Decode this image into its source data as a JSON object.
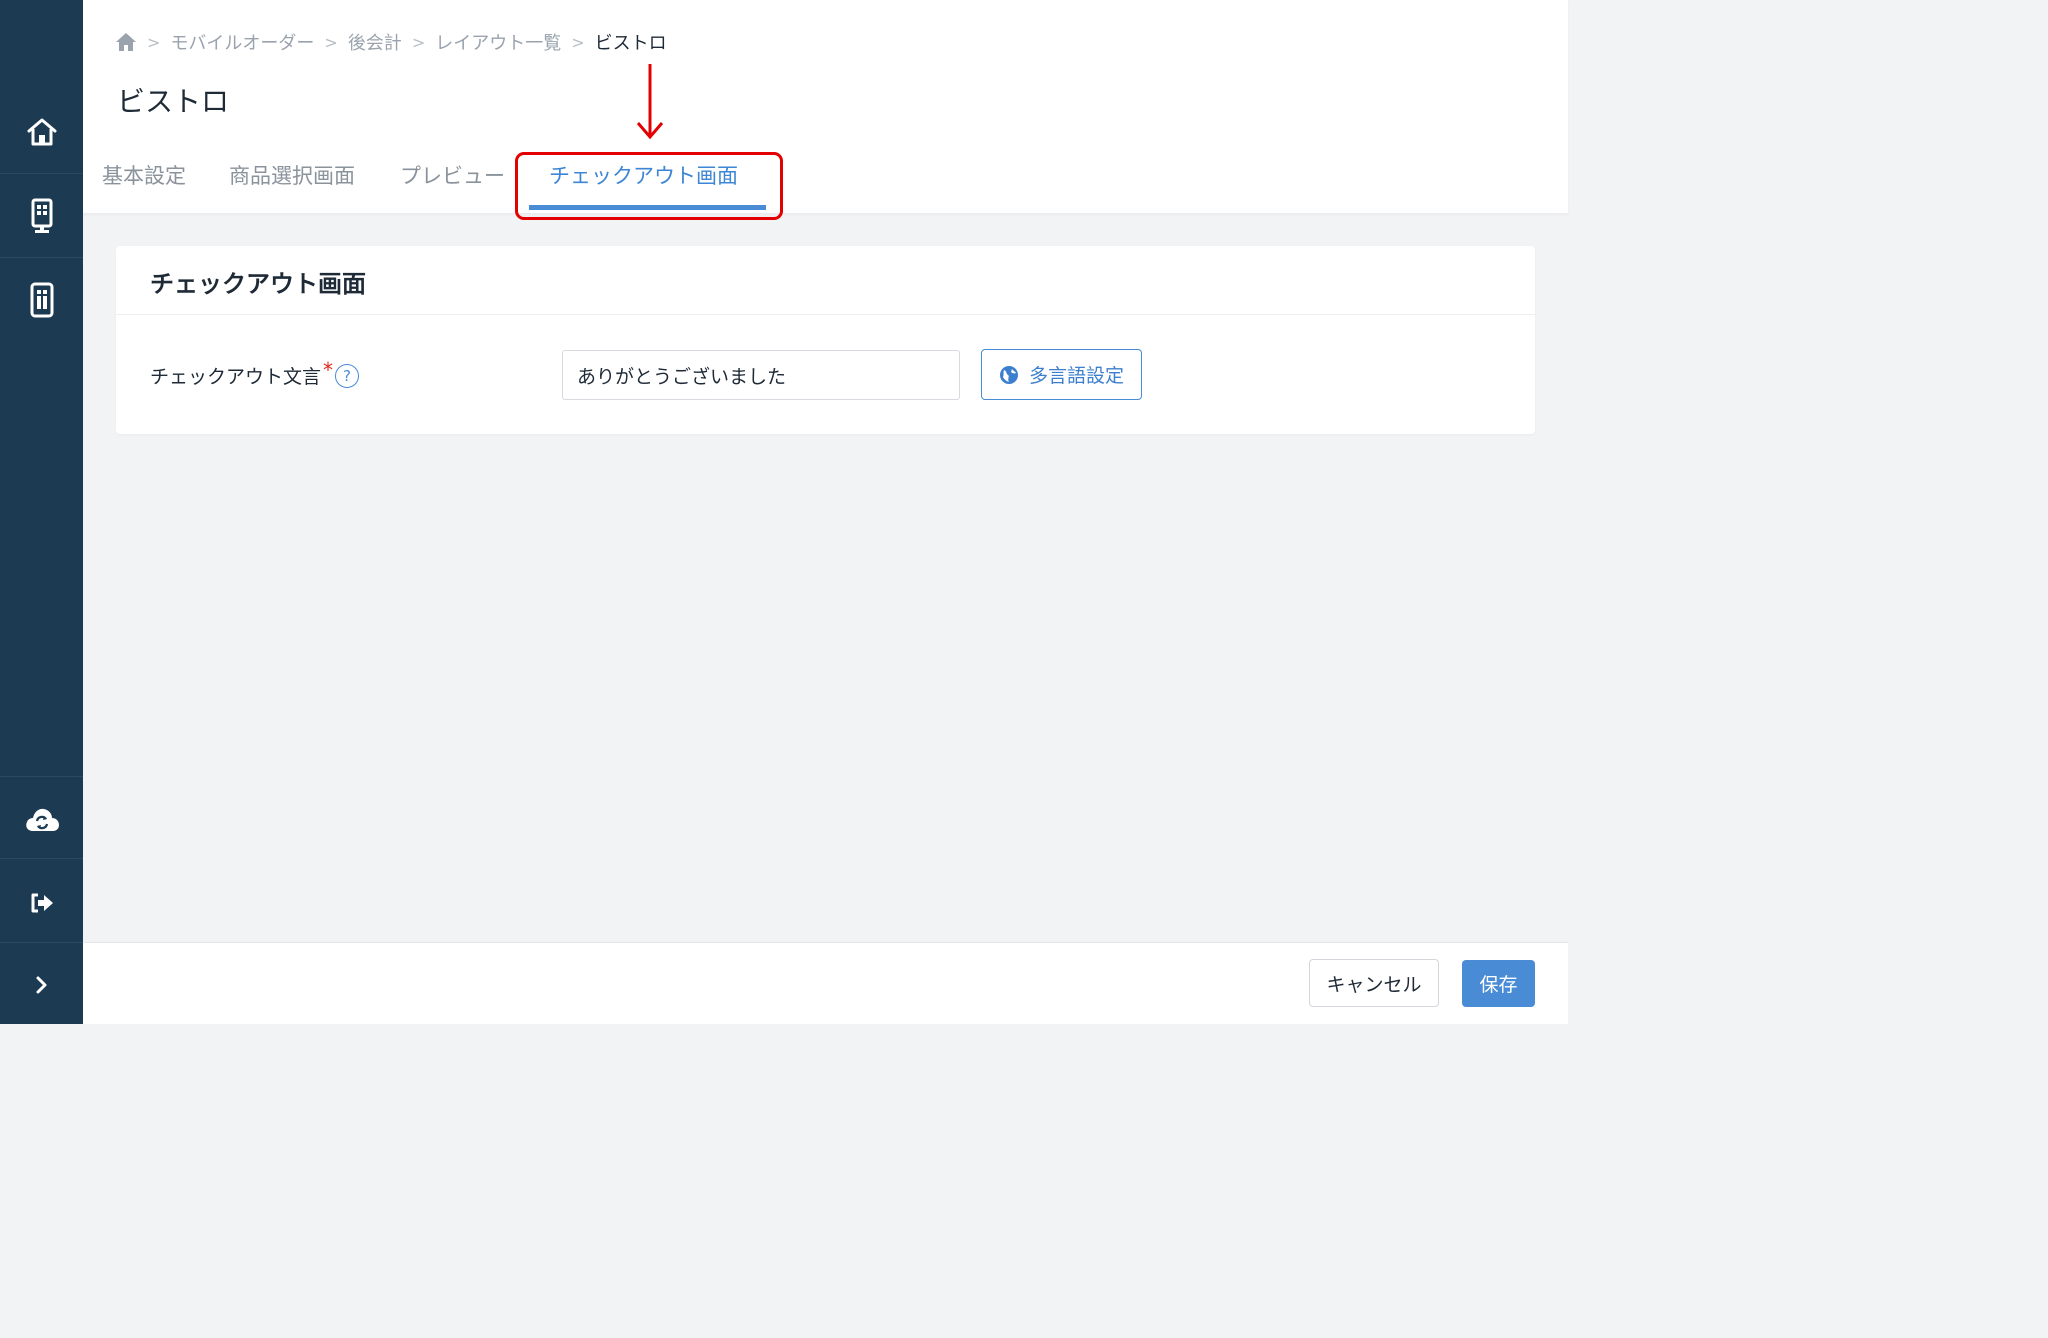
{
  "sidebar": {
    "items": [
      {
        "icon": "home-icon"
      },
      {
        "icon": "kiosk-terminal-icon"
      },
      {
        "icon": "mobile-order-icon"
      },
      {
        "icon": "cloud-sync-icon"
      },
      {
        "icon": "logout-icon"
      },
      {
        "icon": "chevron-right-icon"
      }
    ]
  },
  "breadcrumb": {
    "items": [
      "モバイルオーダー",
      "後会計",
      "レイアウト一覧"
    ],
    "current": "ビストロ"
  },
  "page": {
    "title": "ビストロ"
  },
  "tabs": [
    {
      "label": "基本設定",
      "active": false
    },
    {
      "label": "商品選択画面",
      "active": false
    },
    {
      "label": "プレビュー",
      "active": false
    },
    {
      "label": "チェックアウト画面",
      "active": true
    }
  ],
  "card": {
    "title": "チェックアウト画面",
    "field": {
      "label": "チェックアウト文言",
      "required_mark": "*",
      "help": "?",
      "value": "ありがとうございました"
    },
    "language_button": "多言語設定"
  },
  "footer": {
    "cancel_label": "キャンセル",
    "save_label": "保存"
  },
  "colors": {
    "sidebar": "#1c3a52",
    "accent": "#4a8bd6",
    "highlight": "#e30000"
  }
}
